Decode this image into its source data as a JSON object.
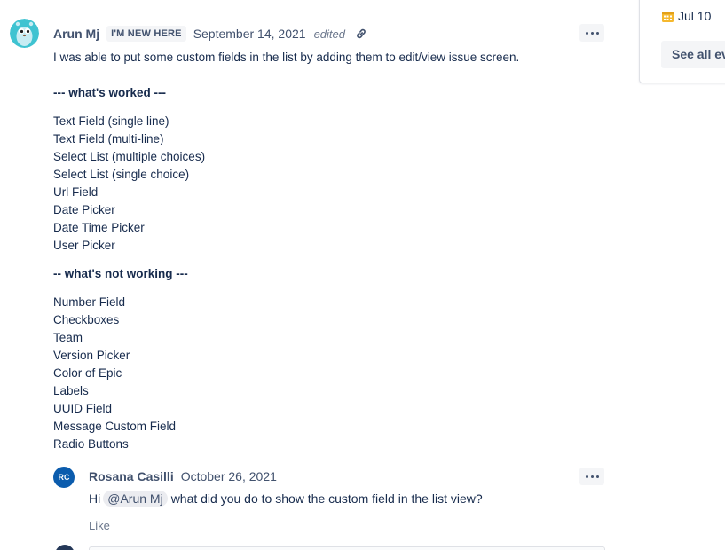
{
  "sidebar": {
    "event_date": "Jul 10",
    "see_all_label": "See all events",
    "calendar_icon": "calendar-icon"
  },
  "comment": {
    "author": "Arun Mj",
    "badge": "I'M NEW HERE",
    "date": "September 14, 2021",
    "edited": "edited",
    "intro": "I was able to put some custom fields in the list by adding them to edit/view issue screen.",
    "worked_heading": "--- what's worked ---",
    "worked_items": [
      "Text Field (single line)",
      "Text Field (multi-line)",
      "Select List (multiple choices)",
      "Select List (single choice)",
      "Url Field",
      "Date Picker",
      "Date Time Picker",
      "User Picker"
    ],
    "not_working_heading": "-- what's not working ---",
    "not_working_items": [
      "Number Field",
      "Checkboxes",
      "Team",
      "Version Picker",
      "Color of Epic",
      "Labels",
      "UUID Field",
      "Message Custom Field",
      "Radio Buttons"
    ]
  },
  "reply": {
    "avatar_initials": "RC",
    "author": "Rosana Casilli",
    "date": "October 26, 2021",
    "greeting": "Hi",
    "mention": "@Arun Mj",
    "text": "what did you do to show the custom field in the list view?",
    "like_label": "Like"
  },
  "colors": {
    "text": "#172b4d",
    "muted": "#42526e",
    "reply_avatar": "#0b5cad",
    "avatar_bg": "#3fc3d1",
    "calendar_icon": "#f5b82e"
  }
}
